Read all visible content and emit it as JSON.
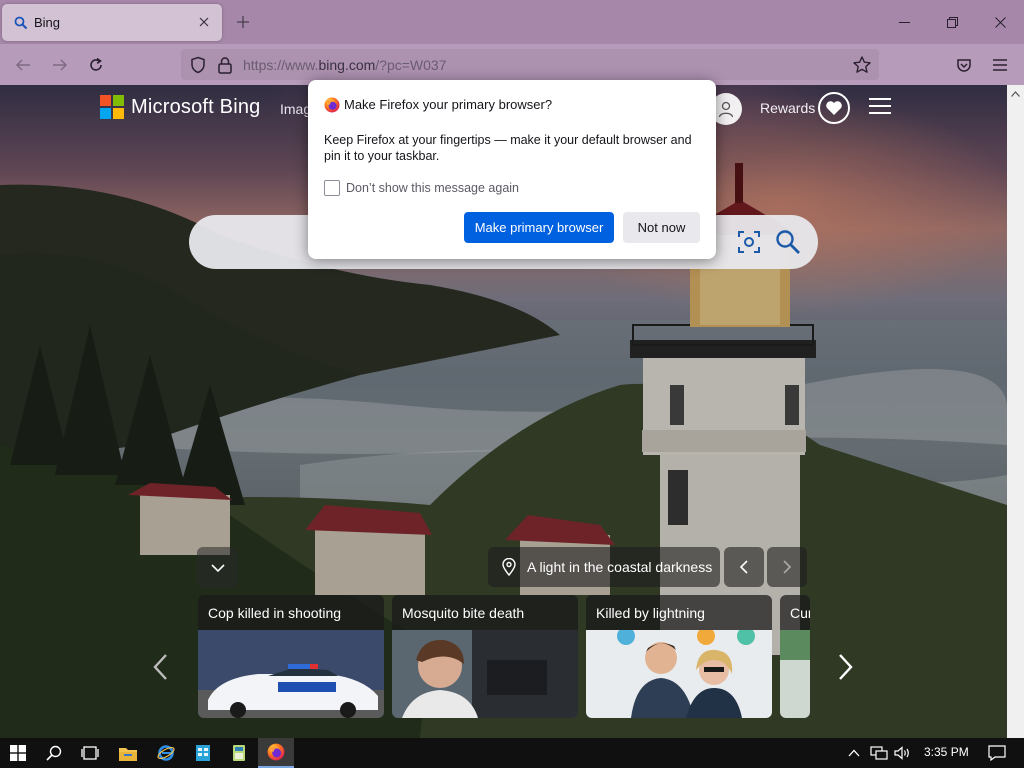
{
  "browser": {
    "tab": {
      "title": "Bing",
      "favicon": "bing-search-favicon"
    },
    "new_tab_icon": "plus-icon",
    "window_controls": [
      "minimize-icon",
      "restore-icon",
      "close-icon"
    ],
    "nav": {
      "back": "arrow-left-icon",
      "forward": "arrow-right-icon",
      "reload": "reload-icon"
    },
    "url": {
      "prefix": "https://www.",
      "host": "bing.com",
      "path": "/?pc=W037"
    },
    "toolbar_icons": [
      "pocket-icon",
      "hamburger-menu-icon"
    ]
  },
  "bing": {
    "logo_text": "Microsoft Bing",
    "nav_images": "Images",
    "rewards_label": "Rewards",
    "location_caption": "A light in the coastal darkness",
    "news_cards": [
      {
        "title": "Cop killed in shooting"
      },
      {
        "title": "Mosquito bite death"
      },
      {
        "title": "Killed by lightning"
      },
      {
        "title": "Cur"
      }
    ]
  },
  "dialog": {
    "title": "Make Firefox your primary browser?",
    "body": "Keep Firefox at your fingertips — make it your default browser and pin it to your taskbar.",
    "checkbox_label": "Don’t show this message again",
    "checkbox_checked": false,
    "primary_button": "Make primary browser",
    "secondary_button": "Not now"
  },
  "taskbar": {
    "clock": "3:35 PM",
    "items": [
      "start-icon",
      "search-icon",
      "task-view-icon",
      "file-explorer-icon",
      "internet-explorer-icon",
      "app-icon",
      "app-icon",
      "firefox-icon"
    ]
  },
  "colors": {
    "accent": "#0061e0",
    "titlebar": "#a687a9",
    "navbar": "#b79bba"
  }
}
